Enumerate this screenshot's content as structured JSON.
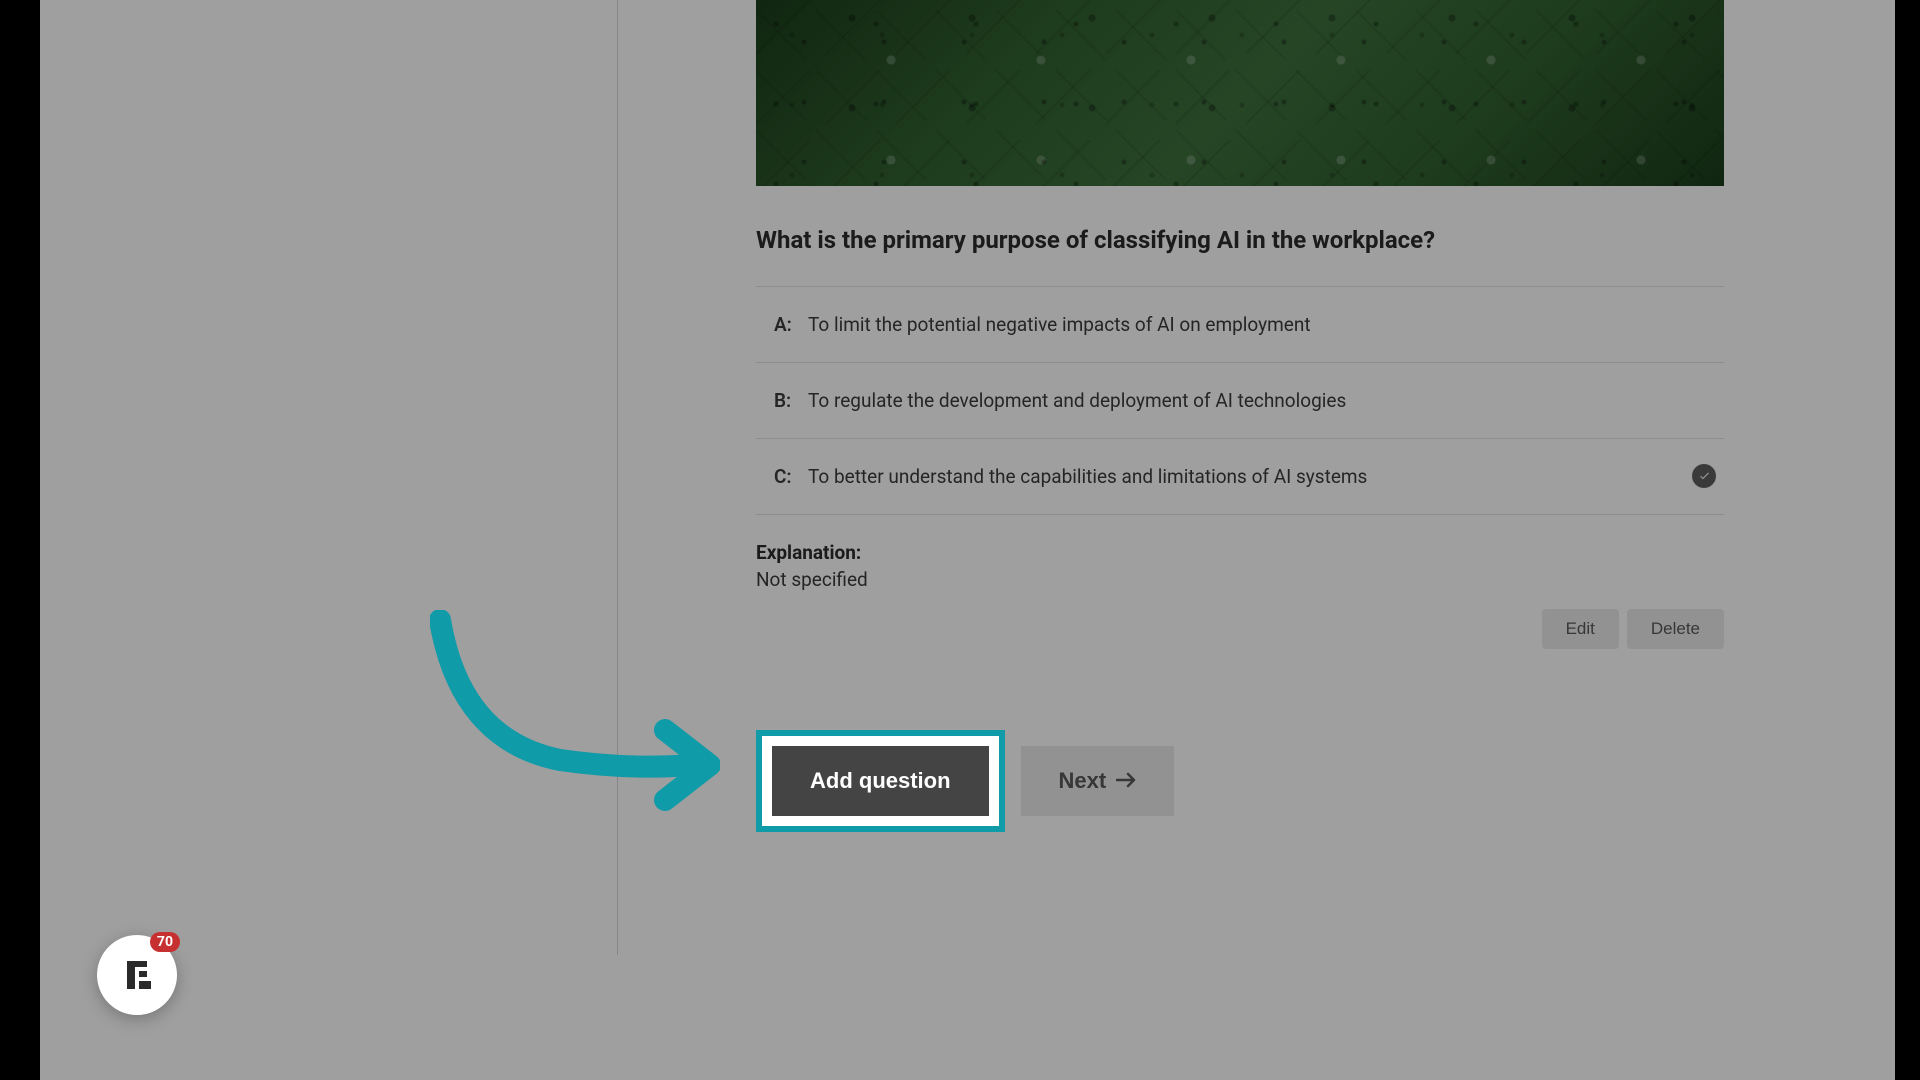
{
  "question": {
    "text": "What is the primary purpose of classifying AI in the workplace?",
    "answers": [
      {
        "letter": "A:",
        "text": "To limit the potential negative impacts of AI on employment",
        "correct": false
      },
      {
        "letter": "B:",
        "text": "To regulate the development and deployment of AI technologies",
        "correct": false
      },
      {
        "letter": "C:",
        "text": "To better understand the capabilities and limitations of AI systems",
        "correct": true
      }
    ],
    "explanation_label": "Explanation:",
    "explanation_text": "Not specified"
  },
  "buttons": {
    "edit": "Edit",
    "delete": "Delete",
    "add_question": "Add question",
    "next": "Next"
  },
  "badge": {
    "count": "70"
  },
  "colors": {
    "highlight": "#0f9ba8",
    "badge_red": "#c73030"
  }
}
